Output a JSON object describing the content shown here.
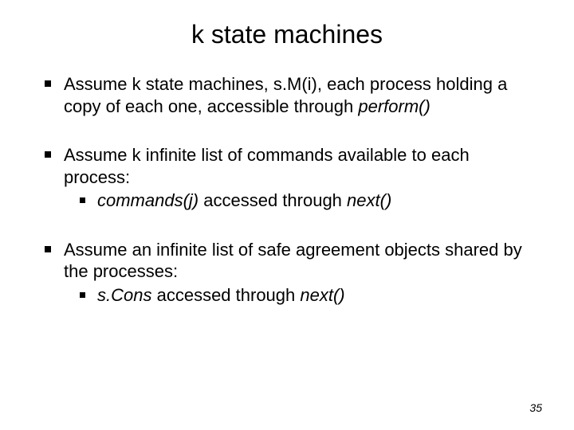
{
  "title": "k state machines",
  "bullets": [
    {
      "pre": "Assume k state machines, s.M(i), each process holding a copy of each one, accessible through ",
      "italic": "perform()",
      "post": ""
    },
    {
      "pre": "Assume k infinite list of commands available to each process:",
      "sub": {
        "italic1": "commands(j)",
        "mid": " accessed through ",
        "italic2": "next()"
      }
    },
    {
      "pre": "Assume an infinite list of safe agreement objects shared by the processes:",
      "sub": {
        "italic1": "s.Cons",
        "mid": " accessed through ",
        "italic2": "next()"
      }
    }
  ],
  "pageNumber": "35"
}
